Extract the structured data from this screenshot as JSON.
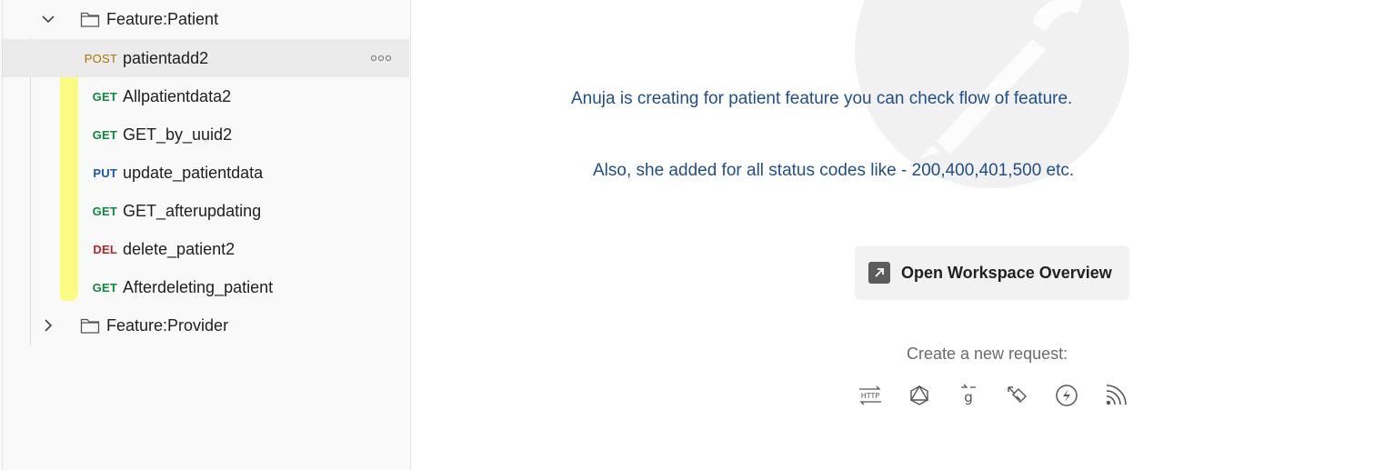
{
  "sidebar": {
    "folders": [
      {
        "label": "Feature:Patient",
        "expanded": true
      },
      {
        "label": "Feature:Provider",
        "expanded": false
      }
    ],
    "requests": [
      {
        "method": "POST",
        "label": "patientadd2",
        "selected": true
      },
      {
        "method": "GET",
        "label": "Allpatientdata2"
      },
      {
        "method": "GET",
        "label": "GET_by_uuid2"
      },
      {
        "method": "PUT",
        "label": "update_patientdata"
      },
      {
        "method": "GET",
        "label": "GET_afterupdating"
      },
      {
        "method": "DEL",
        "label": "delete_patient2"
      },
      {
        "method": "GET",
        "label": "Afterdeleting_patient"
      }
    ]
  },
  "main": {
    "description_line1": "Anuja is creating for patient feature you can check flow of feature.",
    "description_line2": "Also, she added for all status codes like - 200,400,401,500 etc.",
    "overview_button": "Open Workspace Overview",
    "create_label": "Create a new request:",
    "request_type_icons": [
      "http-icon",
      "graphql-icon",
      "grpc-icon",
      "websocket-icon",
      "socketio-icon",
      "mqtt-icon"
    ]
  },
  "colors": {
    "get": "#0e8a3c",
    "post": "#a87300",
    "put": "#1a56b8",
    "del": "#b0262b",
    "description": "#1f4f8b",
    "highlighter": "#fbfb7a"
  }
}
